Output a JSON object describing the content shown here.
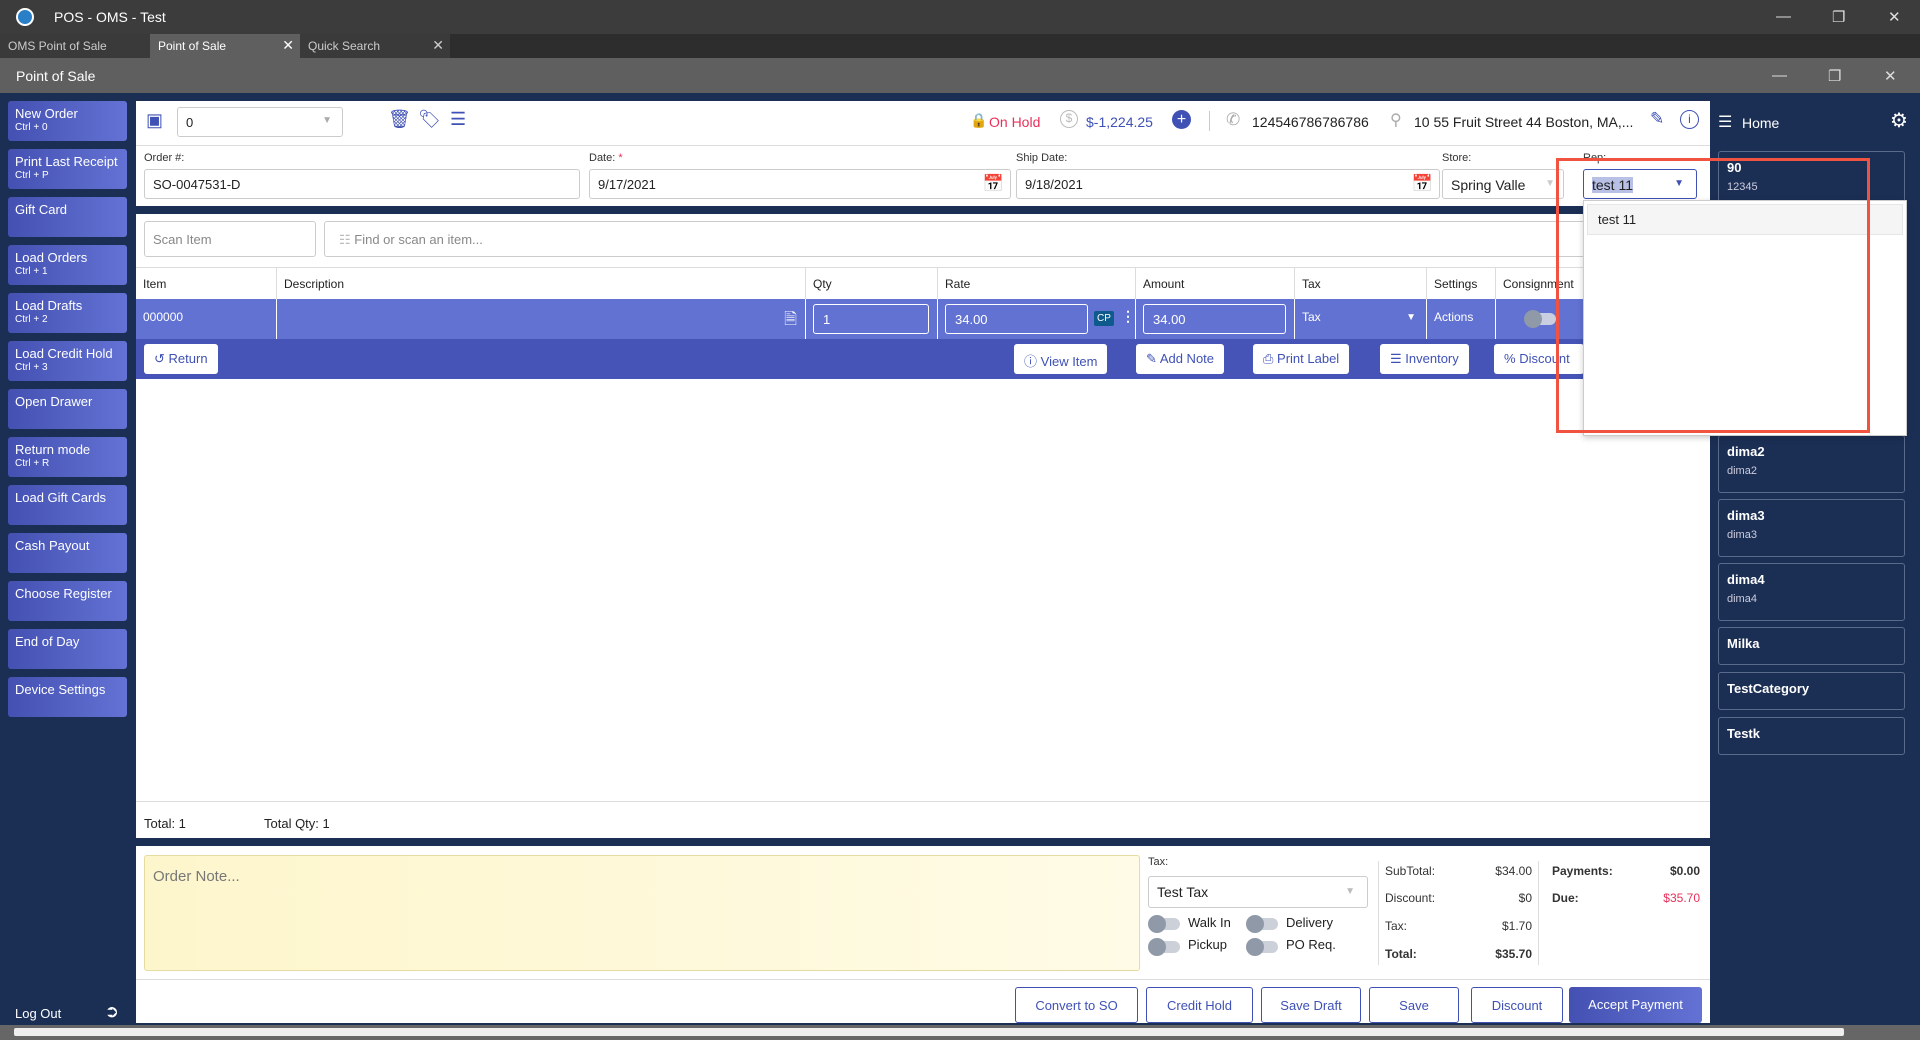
{
  "window": {
    "title": "POS - OMS - Test"
  },
  "tabs": [
    {
      "label": "OMS Point of Sale"
    },
    {
      "label": "Point of Sale"
    },
    {
      "label": "Quick Search"
    }
  ],
  "page_title": "Point of Sale",
  "sidebar": [
    {
      "label": "New Order",
      "shortcut": "Ctrl + 0"
    },
    {
      "label": "Print Last Receipt",
      "shortcut": "Ctrl + P"
    },
    {
      "label": "Gift Card",
      "shortcut": ""
    },
    {
      "label": "Load Orders",
      "shortcut": "Ctrl + 1"
    },
    {
      "label": "Load Drafts",
      "shortcut": "Ctrl + 2"
    },
    {
      "label": "Load Credit Hold",
      "shortcut": "Ctrl + 3"
    },
    {
      "label": "Open Drawer",
      "shortcut": ""
    },
    {
      "label": "Return mode",
      "shortcut": "Ctrl + R"
    },
    {
      "label": "Load Gift Cards",
      "shortcut": ""
    },
    {
      "label": "Cash Payout",
      "shortcut": ""
    },
    {
      "label": "Choose Register",
      "shortcut": ""
    },
    {
      "label": "End of Day",
      "shortcut": ""
    },
    {
      "label": "Device Settings",
      "shortcut": ""
    }
  ],
  "logout": "Log Out",
  "header": {
    "customer": "0",
    "status": "On Hold",
    "balance": "$-1,224.25",
    "phone": "124546786786786",
    "address": "10 55 Fruit Street 44 Boston, MA,..."
  },
  "order": {
    "order_label": "Order #:",
    "order_value": "SO-0047531-D",
    "date_label": "Date:",
    "date_required": "*",
    "date_value": "9/17/2021",
    "ship_label": "Ship Date:",
    "ship_value": "9/18/2021",
    "store_label": "Store:",
    "store_value": "Spring Valle",
    "rep_label": "Rep:",
    "rep_value": "test 11"
  },
  "rep_dropdown": {
    "options": [
      "test 11"
    ]
  },
  "scan": {
    "scan_placeholder": "Scan Item",
    "find_placeholder": "Find or scan an item..."
  },
  "table": {
    "columns": [
      "Item",
      "Description",
      "Qty",
      "Rate",
      "Amount",
      "Tax",
      "Settings",
      "Consignment"
    ],
    "row": {
      "item": "000000",
      "description": "",
      "qty": "1",
      "rate": "34.00",
      "cp": "CP",
      "amount": "34.00",
      "tax": "Tax",
      "settings": "Actions"
    }
  },
  "actions": {
    "return": "Return",
    "view_item": "View Item",
    "add_note": "Add Note",
    "print_label": "Print Label",
    "inventory": "Inventory",
    "discount": "Discount"
  },
  "totals": {
    "total": "Total: 1",
    "total_qty": "Total Qty: 1"
  },
  "note_placeholder": "Order Note...",
  "tax": {
    "label": "Tax:",
    "value": "Test Tax",
    "toggles": [
      "Walk In",
      "Delivery",
      "Pickup",
      "PO Req."
    ]
  },
  "summary": {
    "subtotal_label": "SubTotal:",
    "subtotal": "$34.00",
    "discount_label": "Discount:",
    "discount": "$0",
    "tax_label": "Tax:",
    "tax": "$1.70",
    "total_label": "Total:",
    "total": "$35.70",
    "payments_label": "Payments:",
    "payments": "$0.00",
    "due_label": "Due:",
    "due": "$35.70"
  },
  "buttons": {
    "convert": "Convert to SO",
    "credit_hold": "Credit Hold",
    "save_draft": "Save Draft",
    "save": "Save",
    "discount": "Discount",
    "accept": "Accept Payment"
  },
  "right": {
    "home": "Home",
    "cards": [
      {
        "title": "90",
        "sub": "12345"
      },
      {
        "title": "dima2",
        "sub": "dima2"
      },
      {
        "title": "dima3",
        "sub": "dima3"
      },
      {
        "title": "dima4",
        "sub": "dima4"
      },
      {
        "title": "Milka",
        "sub": ""
      },
      {
        "title": "TestCategory",
        "sub": ""
      },
      {
        "title": "Testk",
        "sub": ""
      }
    ]
  },
  "colors": {
    "accent": "#3f51b5",
    "navy": "#1b2f55",
    "row": "#6272d2",
    "danger": "#e8305a",
    "highlight": "#f0533f"
  }
}
